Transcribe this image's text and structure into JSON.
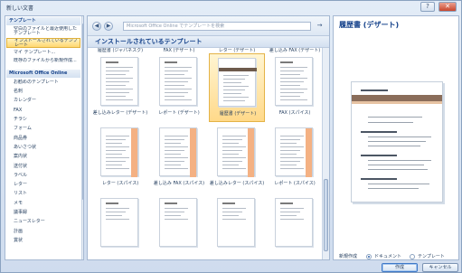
{
  "window": {
    "title": "新しい文書",
    "help_glyph": "?",
    "close_glyph": "✕"
  },
  "sidebar": {
    "items": [
      {
        "label": "テンプレート",
        "kind": "header"
      },
      {
        "label": "空白のファイルと最近使用したテンプレート",
        "kind": "item"
      },
      {
        "label": "インストールされているテンプレート",
        "kind": "selected"
      },
      {
        "label": "マイ テンプレート...",
        "kind": "item"
      },
      {
        "label": "既存のファイルから新規作成...",
        "kind": "item"
      },
      {
        "label": "Microsoft Office Online",
        "kind": "header"
      },
      {
        "label": "お勧めのテンプレート",
        "kind": "item"
      },
      {
        "label": "名刺",
        "kind": "item"
      },
      {
        "label": "カレンダー",
        "kind": "item"
      },
      {
        "label": "FAX",
        "kind": "item"
      },
      {
        "label": "チラシ",
        "kind": "item"
      },
      {
        "label": "フォーム",
        "kind": "item"
      },
      {
        "label": "商品券",
        "kind": "item"
      },
      {
        "label": "あいさつ状",
        "kind": "item"
      },
      {
        "label": "案内状",
        "kind": "item"
      },
      {
        "label": "送付状",
        "kind": "item"
      },
      {
        "label": "ラベル",
        "kind": "item"
      },
      {
        "label": "レター",
        "kind": "item"
      },
      {
        "label": "リスト",
        "kind": "item"
      },
      {
        "label": "メモ",
        "kind": "item"
      },
      {
        "label": "議事録",
        "kind": "item"
      },
      {
        "label": "ニュースレター",
        "kind": "item"
      },
      {
        "label": "計画",
        "kind": "item"
      },
      {
        "label": "賞状",
        "kind": "item"
      }
    ]
  },
  "nav": {
    "back_glyph": "◀",
    "forward_glyph": "▶",
    "search_placeholder": "Microsoft Office Online でテンプレートを検索",
    "search_glyph": "→"
  },
  "gallery": {
    "heading": "インストールされているテンプレート",
    "top_labels": [
      "履歴書 (ジャパネスク)",
      "FAX (デザート)",
      "レター (デザート)",
      "差し込み FAX (デザート)"
    ],
    "rows": [
      [
        {
          "label": "差し込みレター (デザート)",
          "style": "letter"
        },
        {
          "label": "レポート (デザート)",
          "style": "report"
        },
        {
          "label": "履歴書 (デザート)",
          "style": "resume",
          "selected": true
        },
        {
          "label": "FAX (スパイス)",
          "style": "fax"
        }
      ],
      [
        {
          "label": "レター (スパイス)",
          "style": "spice"
        },
        {
          "label": "差し込み FAX (スパイス)",
          "style": "spice"
        },
        {
          "label": "差し込みレター (スパイス)",
          "style": "spice"
        },
        {
          "label": "レポート (スパイス)",
          "style": "spice"
        }
      ],
      [
        {
          "label": "",
          "style": "fax2"
        },
        {
          "label": "",
          "style": "fax2"
        },
        {
          "label": "",
          "style": "fax2"
        },
        {
          "label": "",
          "style": "fax2"
        }
      ]
    ]
  },
  "preview": {
    "title": "履歴書 (デザート)",
    "options_label": "新規作成",
    "option_document": "ドキュメント",
    "option_template": "テンプレート",
    "create_label": "作成",
    "cancel_label": "キャンセル",
    "colors": {
      "accent_band": "#8a6d5a",
      "accent_light": "#e7c3a3",
      "spice_bar": "#f4b183"
    }
  }
}
